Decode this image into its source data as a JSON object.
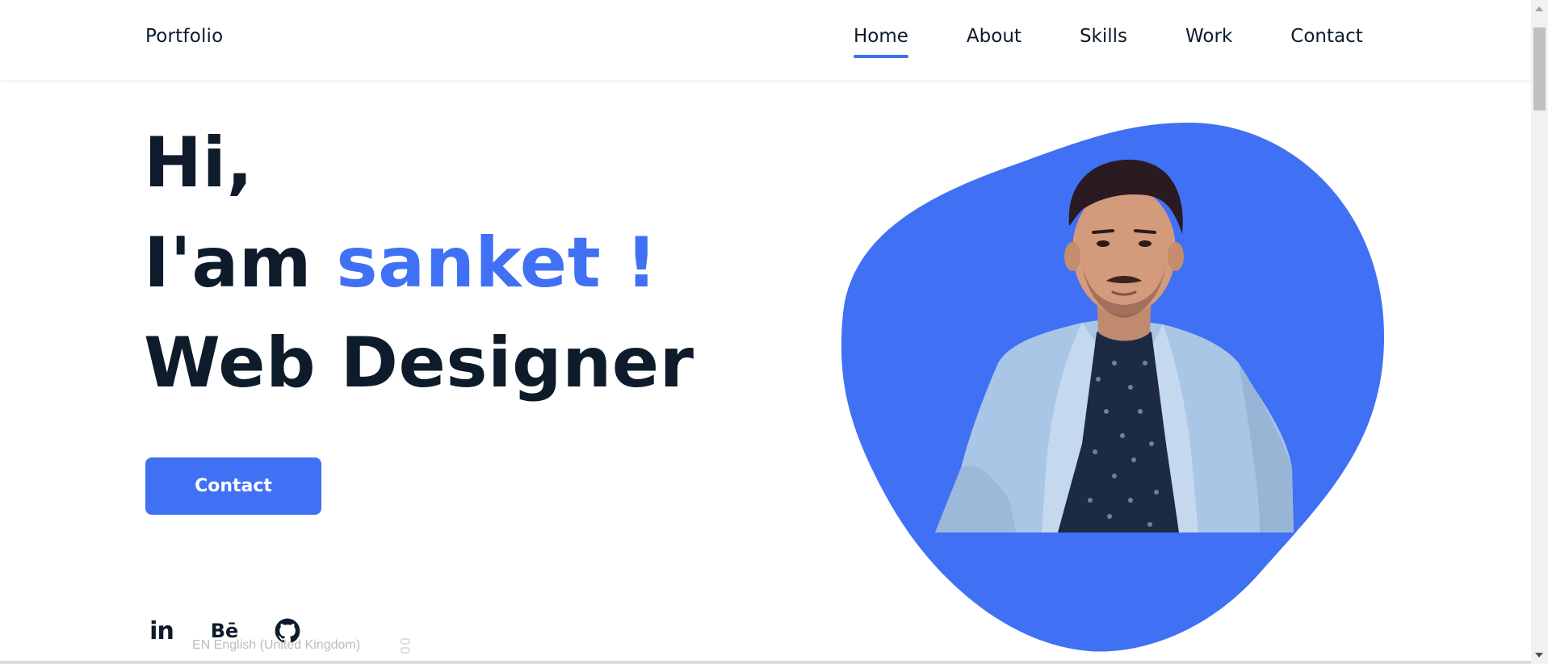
{
  "header": {
    "logo": "Portfolio",
    "nav": [
      {
        "label": "Home",
        "active": true
      },
      {
        "label": "About",
        "active": false
      },
      {
        "label": "Skills",
        "active": false
      },
      {
        "label": "Work",
        "active": false
      },
      {
        "label": "Contact",
        "active": false
      }
    ]
  },
  "hero": {
    "line1": "Hi,",
    "line2_prefix": "I'am ",
    "line2_name": "sanket !",
    "line3": "Web Designer",
    "cta_label": "Contact"
  },
  "socials": [
    {
      "name": "linkedin",
      "glyph": "in"
    },
    {
      "name": "behance",
      "glyph": "Bē"
    },
    {
      "name": "github",
      "glyph": ""
    }
  ],
  "language_bar": "EN English (United Kingdom)",
  "colors": {
    "accent": "#4070f4",
    "text_dark": "#0d1b2a",
    "background": "#ffffff"
  }
}
